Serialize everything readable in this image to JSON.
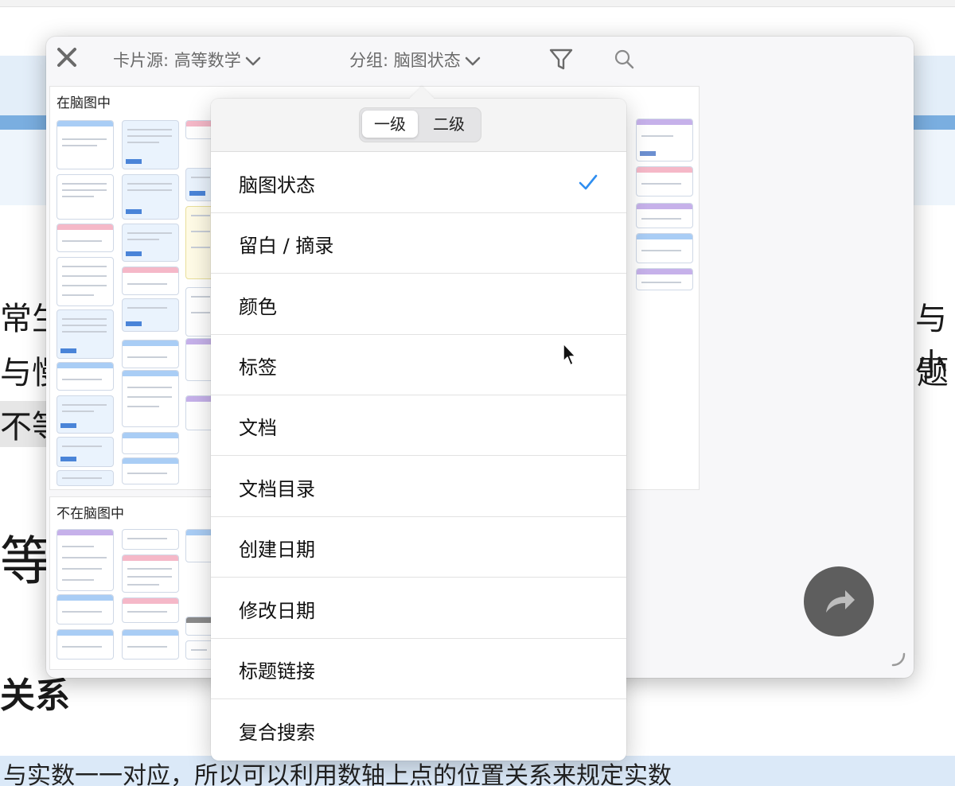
{
  "background": {
    "fragments": [
      "常生",
      "与慢",
      "不等",
      "等",
      "关系",
      "与小",
      "题",
      "与实数一一对应，所以可以利用数轴上点的位置关系来规定实数"
    ]
  },
  "toolbar": {
    "card_source": "卡片源: 高等数学",
    "group_by": "分组: 脑图状态",
    "icons": [
      "close-icon",
      "chevron-down-icon",
      "filter-icon",
      "search-icon"
    ]
  },
  "groups": [
    {
      "label": "在脑图中"
    },
    {
      "label": "不在脑图中"
    }
  ],
  "menu": {
    "levels": [
      "一级",
      "二级"
    ],
    "active_level": "一级",
    "selected": "脑图状态",
    "items": [
      "脑图状态",
      "留白 / 摘录",
      "颜色",
      "标签",
      "文档",
      "文档目录",
      "创建日期",
      "修改日期",
      "标题链接",
      "复合搜索"
    ]
  },
  "colors": {
    "accent": "#2f8ef0",
    "card_blue": "#a9cdf5",
    "card_pink": "#f5b8c8",
    "card_purple": "#c6b1ea",
    "share_button": "#5e5e5e"
  }
}
